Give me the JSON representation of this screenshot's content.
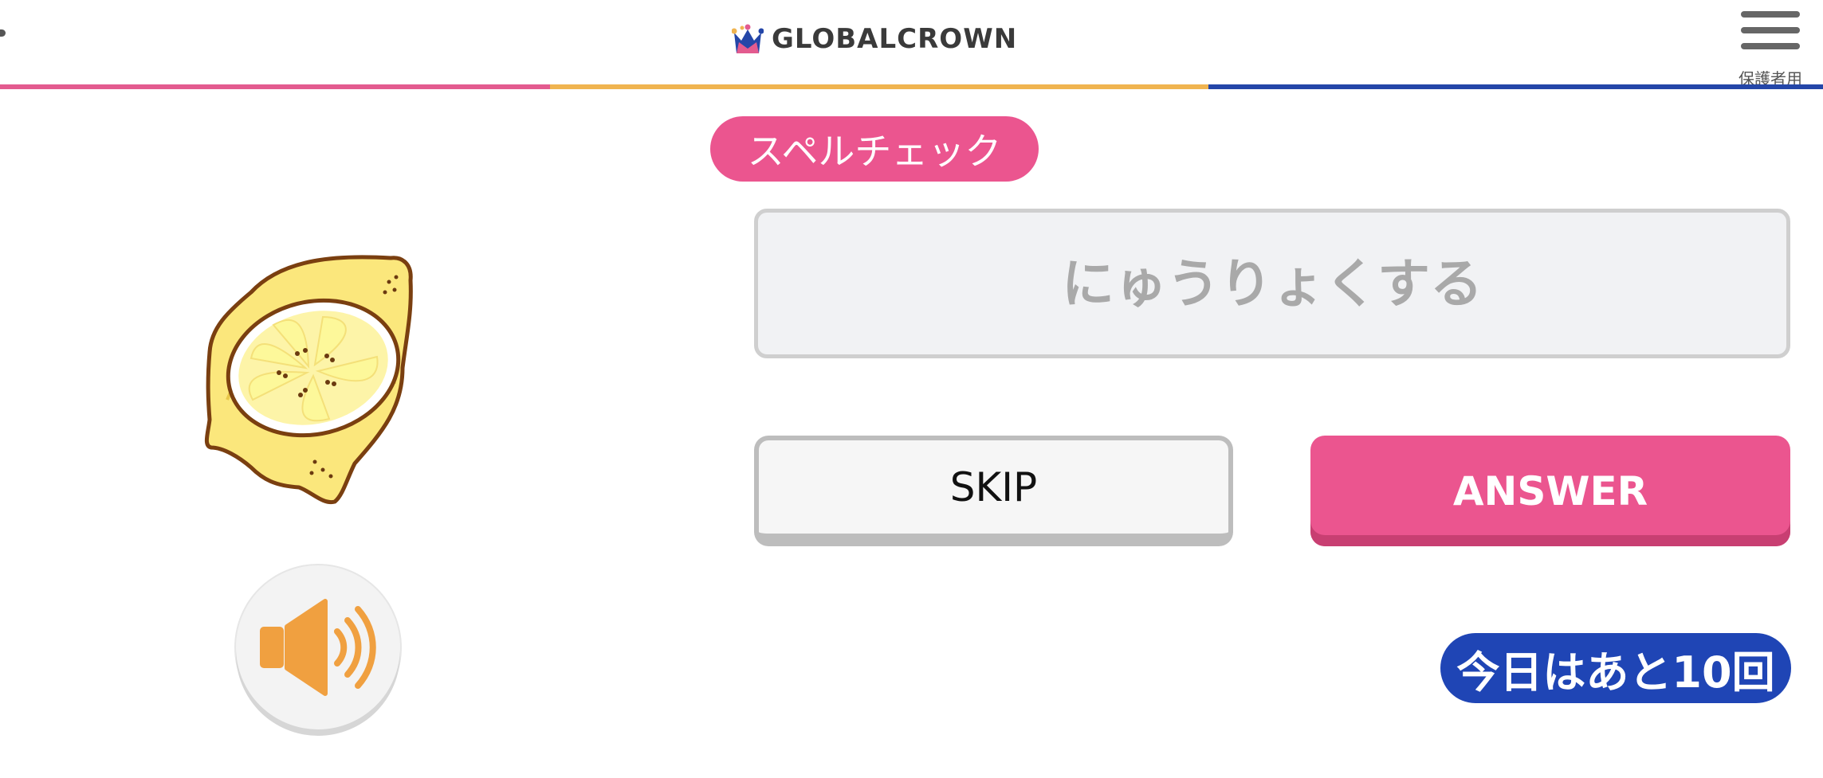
{
  "header": {
    "logo_text": "GLOBALCROWN",
    "menu_label": "保護者用",
    "stripe_colors": [
      "#e35b8f",
      "#f0b450",
      "#2446a8"
    ]
  },
  "exercise": {
    "mode_label": "スペルチェック",
    "input_placeholder": "にゅうりょくする",
    "input_value": "",
    "skip_label": "SKIP",
    "answer_label": "ANSWER",
    "remaining_label": "今日はあと10回",
    "image_icon": "lemon-icon",
    "sound_icon": "speaker-icon"
  },
  "colors": {
    "pink": "#eb558f",
    "pink_shadow": "#c83f72",
    "blue": "#1f45b5",
    "speaker": "#f0a040"
  }
}
